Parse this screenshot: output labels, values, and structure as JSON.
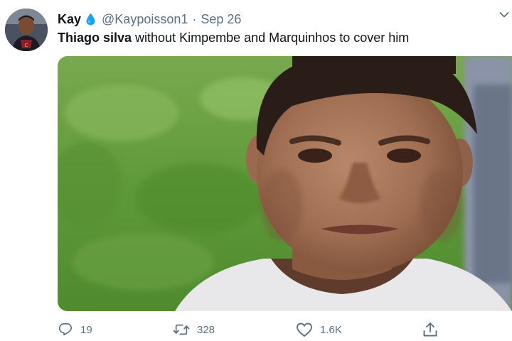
{
  "tweet": {
    "author_name": "Kay",
    "handle": "@Kaypoisson1",
    "separator": "·",
    "date": "Sep 26",
    "text_bold": "Thiago silva",
    "text_rest": " without Kimpembe and Marquinhos to cover him",
    "badge_icon": "water-drop-icon",
    "badge_color": "#1da1f2"
  },
  "actions": {
    "reply_count": "19",
    "retweet_count": "328",
    "like_count": "1.6K"
  },
  "colors": {
    "secondary_text": "#5b7083",
    "primary_text": "#0f1419",
    "accent": "#1da1f2"
  }
}
